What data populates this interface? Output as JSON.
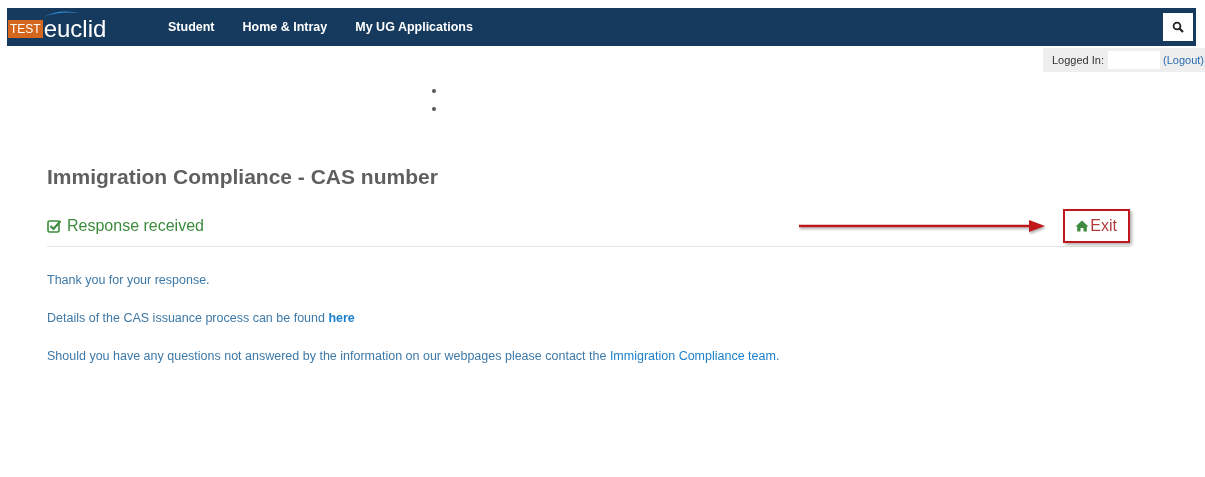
{
  "brand": {
    "badge": "TEST",
    "name": "euclid"
  },
  "nav": [
    {
      "label": "Student"
    },
    {
      "label": "Home & Intray"
    },
    {
      "label": "My UG Applications"
    }
  ],
  "session": {
    "label": "Logged In:",
    "logout": "(Logout)"
  },
  "title": "Immigration Compliance - CAS number",
  "status": {
    "kind": "success",
    "text": "Response received"
  },
  "exit": {
    "label": "Exit",
    "highlighted": true
  },
  "paragraphs": [
    {
      "text": "Thank you for your response."
    },
    {
      "text": "Details of the CAS issuance process can be found ",
      "link": "here",
      "link_bold": true
    },
    {
      "text": "Should you have any questions not answered by the information on our webpages please contact the ",
      "link": "Immigration Compliance team",
      "link_bold": false,
      "after": "."
    }
  ]
}
